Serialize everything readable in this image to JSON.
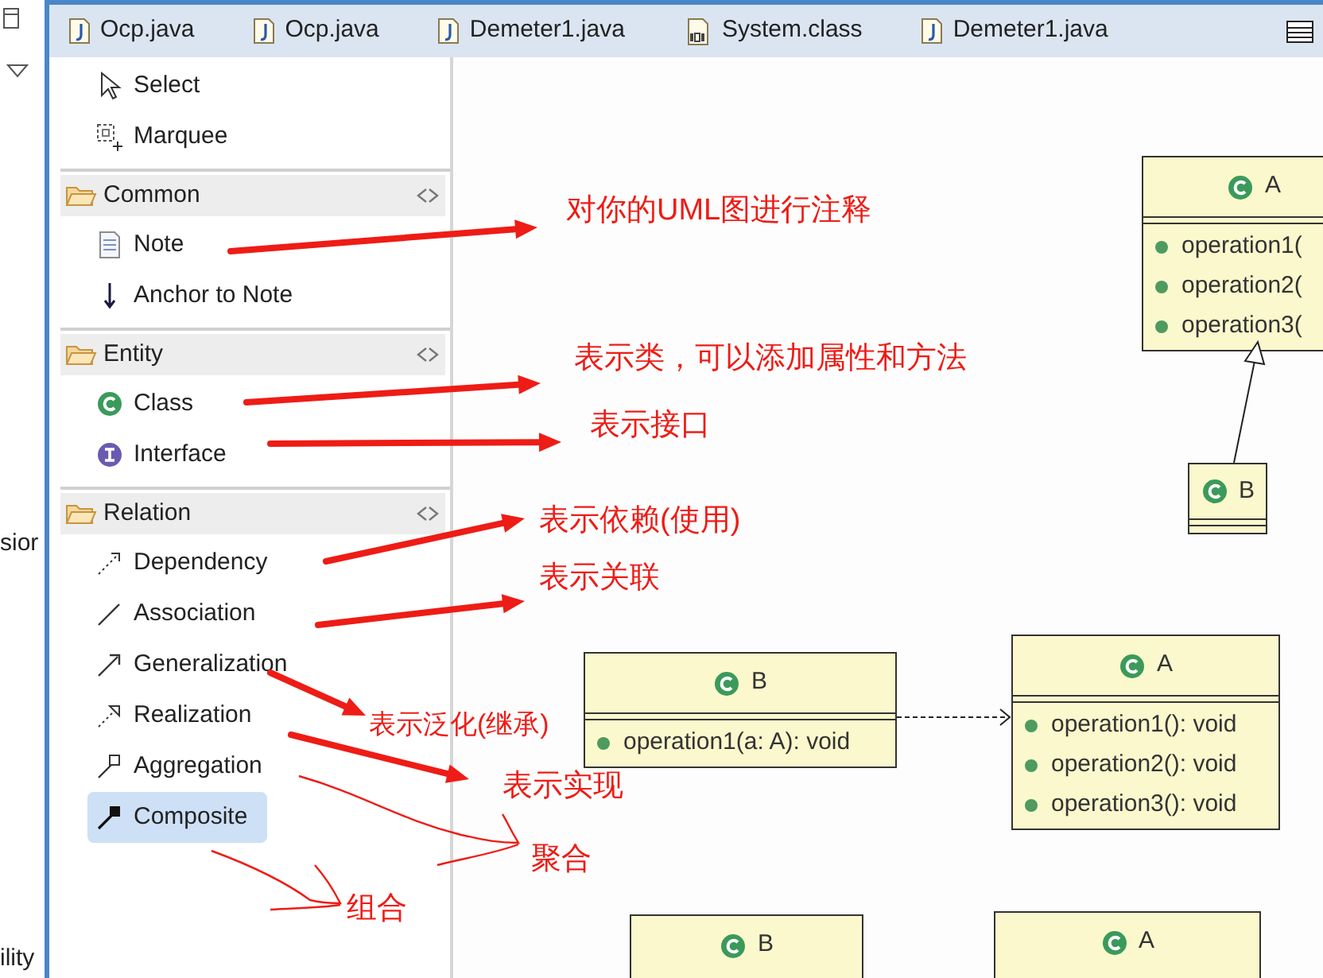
{
  "side_strip": {
    "texts": [
      "sior",
      "ility"
    ]
  },
  "tabs": [
    {
      "label": "Ocp.java",
      "kind": "java"
    },
    {
      "label": "Ocp.java",
      "kind": "java"
    },
    {
      "label": "Demeter1.java",
      "kind": "java"
    },
    {
      "label": "System.class",
      "kind": "class"
    },
    {
      "label": "Demeter1.java",
      "kind": "java"
    }
  ],
  "palette": {
    "tools": [
      {
        "label": "Select",
        "kind": "select",
        "selected": false
      },
      {
        "label": "Marquee",
        "kind": "marquee",
        "selected": false
      }
    ],
    "drawers": [
      {
        "title": "Common",
        "items": [
          {
            "label": "Note",
            "kind": "note",
            "selected": false
          },
          {
            "label": "Anchor to Note",
            "kind": "anchor",
            "selected": false
          }
        ]
      },
      {
        "title": "Entity",
        "items": [
          {
            "label": "Class",
            "kind": "class",
            "selected": false
          },
          {
            "label": "Interface",
            "kind": "interface",
            "selected": false
          }
        ]
      },
      {
        "title": "Relation",
        "items": [
          {
            "label": "Dependency",
            "kind": "dependency",
            "selected": false
          },
          {
            "label": "Association",
            "kind": "association",
            "selected": false
          },
          {
            "label": "Generalization",
            "kind": "generalization",
            "selected": false
          },
          {
            "label": "Realization",
            "kind": "realization",
            "selected": false
          },
          {
            "label": "Aggregation",
            "kind": "aggregation",
            "selected": false
          },
          {
            "label": "Composite",
            "kind": "composite",
            "selected": true
          }
        ]
      }
    ]
  },
  "diagram": {
    "classes": [
      {
        "name": "A",
        "operations": [
          "operation1(",
          "operation2(",
          "operation3("
        ]
      },
      {
        "name": "B"
      },
      {
        "name": "B",
        "operations": [
          "operation1(a: A): void"
        ]
      },
      {
        "name": "A",
        "operations": [
          "operation1(): void",
          "operation2(): void",
          "operation3(): void"
        ]
      },
      {
        "name": "B"
      },
      {
        "name": "A"
      }
    ]
  },
  "annotations": [
    {
      "text": "对你的UML图进行注释"
    },
    {
      "text": "表示类，可以添加属性和方法"
    },
    {
      "text": "表示接口"
    },
    {
      "text": "表示依赖(使用)"
    },
    {
      "text": "表示关联"
    },
    {
      "text": "表示泛化(继承)"
    },
    {
      "text": "表示实现"
    },
    {
      "text": "聚合"
    },
    {
      "text": "组合"
    }
  ]
}
